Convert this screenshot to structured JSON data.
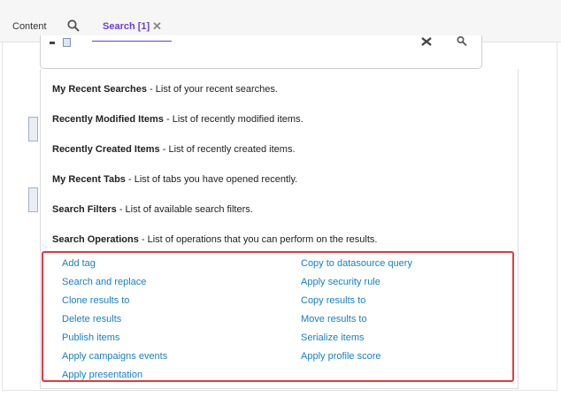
{
  "tabs": {
    "content_label": "Content",
    "search_label": "Search [1]"
  },
  "dropdown": {
    "items": [
      {
        "title": "My Recent Searches",
        "description": " - List of your recent searches."
      },
      {
        "title": "Recently Modified Items",
        "description": " - List of recently modified items."
      },
      {
        "title": "Recently Created Items",
        "description": " - List of recently created items."
      },
      {
        "title": "My Recent Tabs",
        "description": " - List of tabs you have opened recently."
      },
      {
        "title": "Search Filters",
        "description": " - List of available search filters."
      },
      {
        "title": "Search Operations",
        "description": " - List of operations that you can perform on the results."
      }
    ]
  },
  "operations": {
    "left": [
      "Add tag",
      "Search and replace",
      "Clone results to",
      "Delete results",
      "Publish items",
      "Apply campaigns events",
      "Apply presentation"
    ],
    "right": [
      "Copy to datasource query",
      "Apply security rule",
      "Copy results to",
      "Move results to",
      "Serialize items",
      "Apply profile score"
    ]
  },
  "colors": {
    "accent": "#6b3fd6",
    "link": "#1a7ec4",
    "highlight_border": "#e03a45"
  }
}
